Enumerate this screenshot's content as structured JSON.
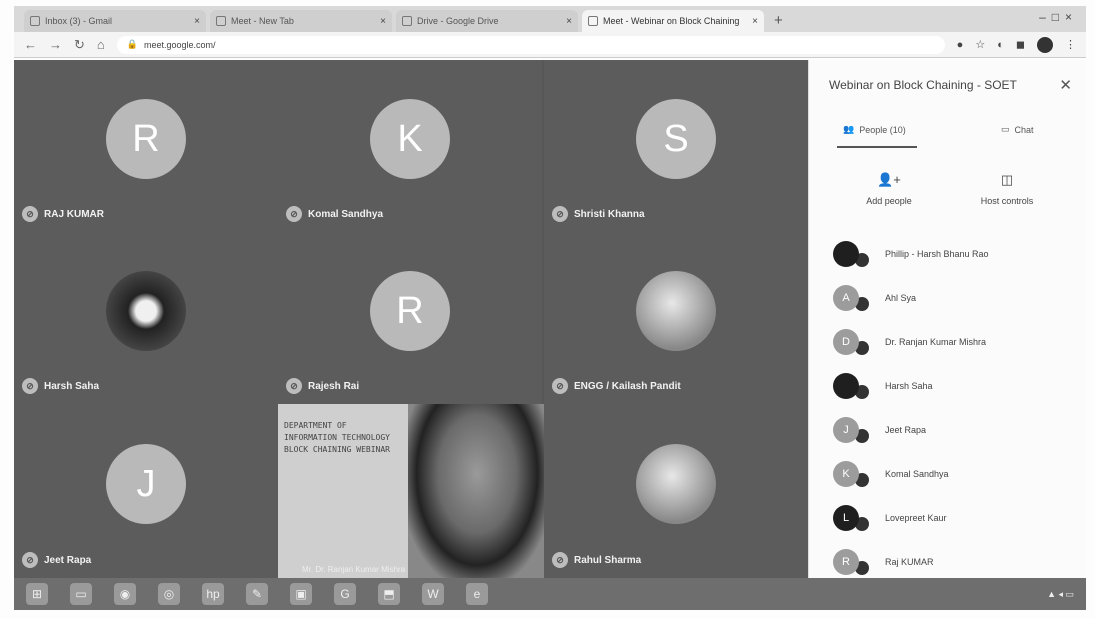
{
  "browser": {
    "tabs": [
      {
        "label": "Inbox (3) - Gmail"
      },
      {
        "label": "Meet - New Tab"
      },
      {
        "label": "Drive - Google Drive"
      },
      {
        "label": "Meet - Webinar on Block Chaining",
        "active": true
      }
    ],
    "url": "meet.google.com/"
  },
  "grid": {
    "tiles": [
      {
        "initial": "R",
        "name": "RAJ KUMAR"
      },
      {
        "initial": "K",
        "name": "Komal Sandhya"
      },
      {
        "initial": "S",
        "name": "Shristi Khanna"
      },
      {
        "initial": "",
        "name": "Harsh Saha"
      },
      {
        "initial": "R",
        "name": "Rajesh Rai"
      },
      {
        "initial": "",
        "name": "ENGG / Kailash Pandit"
      },
      {
        "initial": "J",
        "name": "Jeet Rapa"
      },
      {
        "initial": "",
        "name": "Rahul Sharma"
      }
    ],
    "presenter": {
      "banner": "DEPARTMENT OF INFORMATION TECHNOLOGY BLOCK CHAINING WEBINAR",
      "name": "Mr. Dr. Ranjan Kumar Mishra"
    }
  },
  "panel": {
    "title": "Webinar on Block Chaining - SOET",
    "people_tab": "People (10)",
    "chat_tab": "Chat",
    "add_people": "Add people",
    "host_controls": "Host controls",
    "participants": [
      {
        "initial": "",
        "name": "Phillip - Harsh Bhanu Rao",
        "dark": true
      },
      {
        "initial": "A",
        "name": "Ahl Sya"
      },
      {
        "initial": "D",
        "name": "Dr. Ranjan Kumar Mishra"
      },
      {
        "initial": "",
        "name": "Harsh Saha",
        "dark": true
      },
      {
        "initial": "J",
        "name": "Jeet Rapa"
      },
      {
        "initial": "K",
        "name": "Komal Sandhya"
      },
      {
        "initial": "L",
        "name": "Lovepreet Kaur",
        "dark": true
      },
      {
        "initial": "R",
        "name": "Raj KUMAR"
      }
    ]
  },
  "taskbar": {
    "apps": [
      "start-icon",
      "task-view-icon",
      "chrome-icon",
      "media-icon",
      "hp-icon",
      "pen-icon",
      "photos-icon",
      "google-icon",
      "pdf-icon",
      "word-icon",
      "edge-icon"
    ],
    "labels": {
      "word": "W",
      "google": "G"
    }
  },
  "colors": {
    "grid_bg": "#575757",
    "avatar": "#b9b9b9",
    "panel_bg": "#fbfbfb"
  }
}
